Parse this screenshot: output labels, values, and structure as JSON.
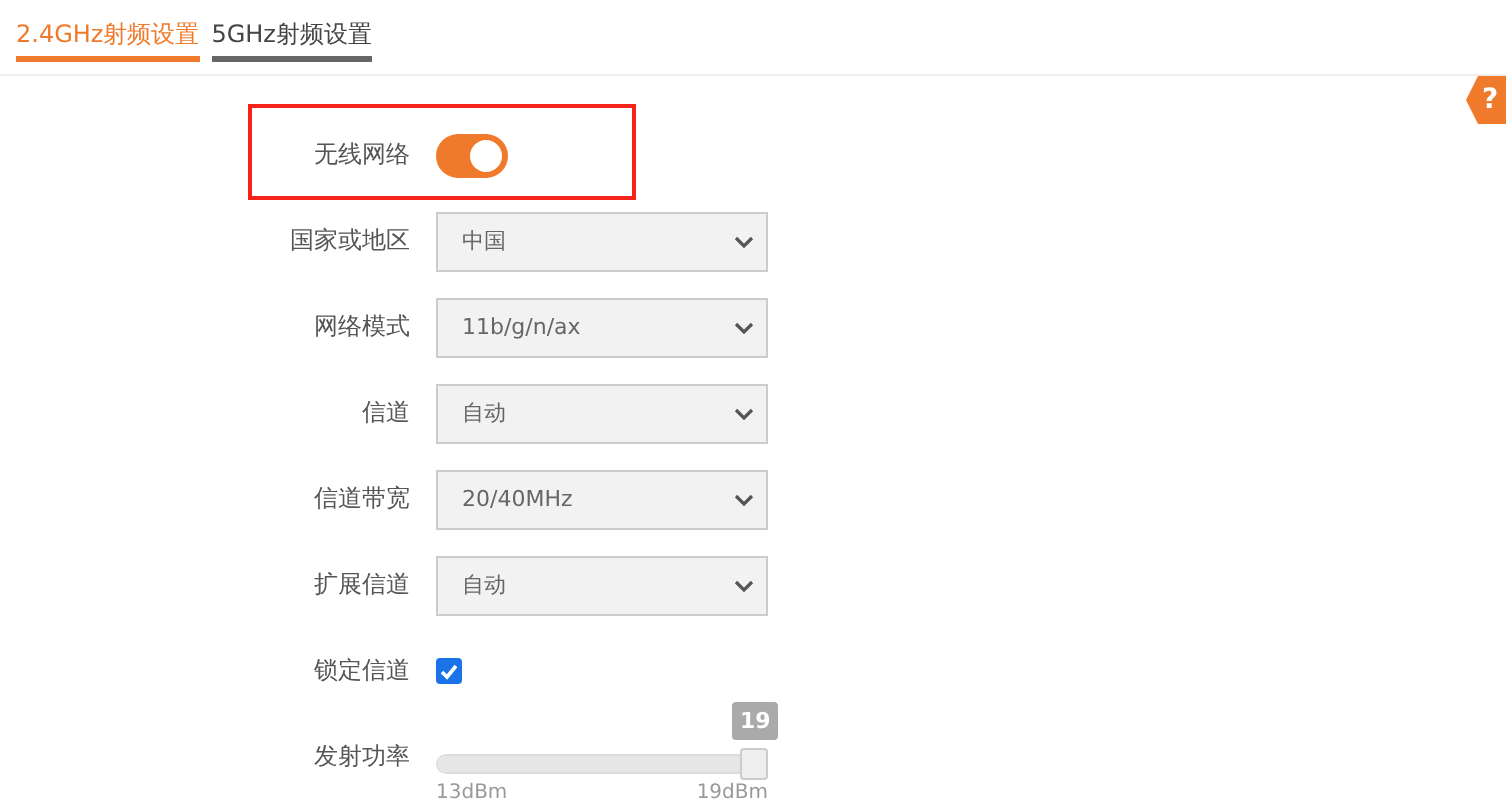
{
  "tabs": [
    {
      "label": "2.4GHz射频设置",
      "selected": true
    },
    {
      "label": "5GHz射频设置",
      "selected": false
    }
  ],
  "help_badge": "?",
  "fields": [
    {
      "kind": "toggle",
      "label": "无线网络",
      "on": true,
      "highlighted": true
    },
    {
      "kind": "select",
      "label": "国家或地区",
      "value": "中国"
    },
    {
      "kind": "select",
      "label": "网络模式",
      "value": "11b/g/n/ax"
    },
    {
      "kind": "select",
      "label": "信道",
      "value": "自动"
    },
    {
      "kind": "select",
      "label": "信道带宽",
      "value": "20/40MHz"
    },
    {
      "kind": "select",
      "label": "扩展信道",
      "value": "自动"
    },
    {
      "kind": "checkbox",
      "label": "锁定信道",
      "checked": true
    },
    {
      "kind": "slider",
      "label": "发射功率",
      "level": 1,
      "value": "19",
      "min_label": "13dBm",
      "max_label": "19dBm"
    }
  ]
}
